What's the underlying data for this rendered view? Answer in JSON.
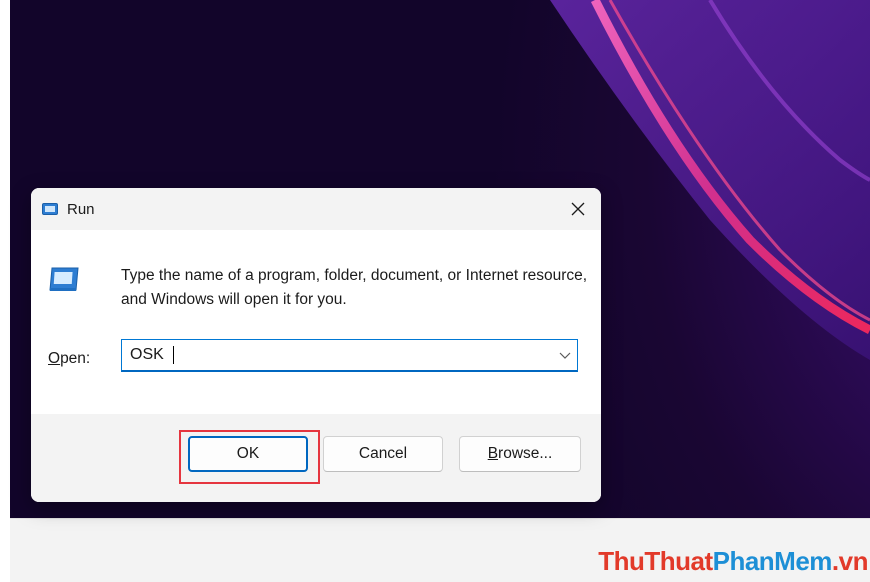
{
  "dialog": {
    "title": "Run",
    "description": "Type the name of a program, folder, document, or Internet resource, and Windows will open it for you.",
    "open_label_mnemonic": "O",
    "open_label_rest": "pen:",
    "input_value": "OSK",
    "ok_label": "OK",
    "cancel_label": "Cancel",
    "browse_mnemonic": "B",
    "browse_rest": "rowse...",
    "icons": [
      "run-icon",
      "close-icon",
      "chevron-down-icon"
    ]
  },
  "highlight": {
    "color": "#e5353f",
    "target": "ok-button"
  },
  "watermark": {
    "part1": "ThuThuat",
    "part2": "PhanMem",
    "part3": ".vn"
  },
  "colors": {
    "accent": "#0067c0",
    "watermark_red": "#e23a2a",
    "watermark_blue": "#1d8fd6"
  }
}
